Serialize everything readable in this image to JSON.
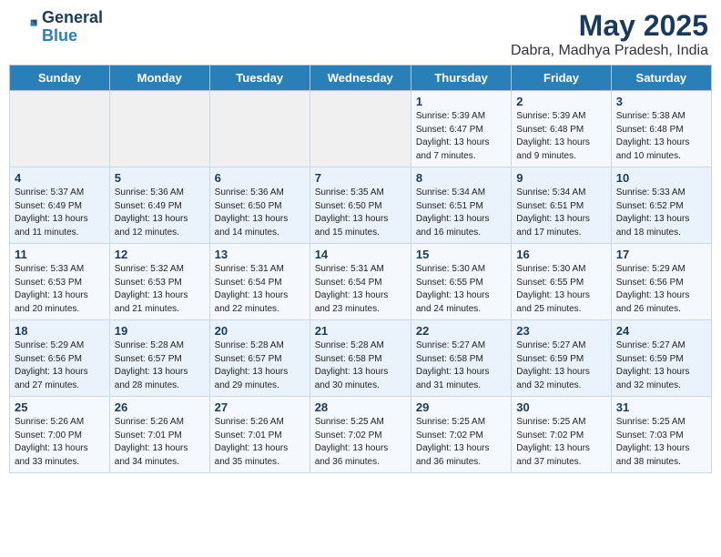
{
  "logo": {
    "line1": "General",
    "line2": "Blue"
  },
  "title": "May 2025",
  "subtitle": "Dabra, Madhya Pradesh, India",
  "days_of_week": [
    "Sunday",
    "Monday",
    "Tuesday",
    "Wednesday",
    "Thursday",
    "Friday",
    "Saturday"
  ],
  "weeks": [
    [
      {
        "day": "",
        "content": ""
      },
      {
        "day": "",
        "content": ""
      },
      {
        "day": "",
        "content": ""
      },
      {
        "day": "",
        "content": ""
      },
      {
        "day": "1",
        "content": "Sunrise: 5:39 AM\nSunset: 6:47 PM\nDaylight: 13 hours\nand 7 minutes."
      },
      {
        "day": "2",
        "content": "Sunrise: 5:39 AM\nSunset: 6:48 PM\nDaylight: 13 hours\nand 9 minutes."
      },
      {
        "day": "3",
        "content": "Sunrise: 5:38 AM\nSunset: 6:48 PM\nDaylight: 13 hours\nand 10 minutes."
      }
    ],
    [
      {
        "day": "4",
        "content": "Sunrise: 5:37 AM\nSunset: 6:49 PM\nDaylight: 13 hours\nand 11 minutes."
      },
      {
        "day": "5",
        "content": "Sunrise: 5:36 AM\nSunset: 6:49 PM\nDaylight: 13 hours\nand 12 minutes."
      },
      {
        "day": "6",
        "content": "Sunrise: 5:36 AM\nSunset: 6:50 PM\nDaylight: 13 hours\nand 14 minutes."
      },
      {
        "day": "7",
        "content": "Sunrise: 5:35 AM\nSunset: 6:50 PM\nDaylight: 13 hours\nand 15 minutes."
      },
      {
        "day": "8",
        "content": "Sunrise: 5:34 AM\nSunset: 6:51 PM\nDaylight: 13 hours\nand 16 minutes."
      },
      {
        "day": "9",
        "content": "Sunrise: 5:34 AM\nSunset: 6:51 PM\nDaylight: 13 hours\nand 17 minutes."
      },
      {
        "day": "10",
        "content": "Sunrise: 5:33 AM\nSunset: 6:52 PM\nDaylight: 13 hours\nand 18 minutes."
      }
    ],
    [
      {
        "day": "11",
        "content": "Sunrise: 5:33 AM\nSunset: 6:53 PM\nDaylight: 13 hours\nand 20 minutes."
      },
      {
        "day": "12",
        "content": "Sunrise: 5:32 AM\nSunset: 6:53 PM\nDaylight: 13 hours\nand 21 minutes."
      },
      {
        "day": "13",
        "content": "Sunrise: 5:31 AM\nSunset: 6:54 PM\nDaylight: 13 hours\nand 22 minutes."
      },
      {
        "day": "14",
        "content": "Sunrise: 5:31 AM\nSunset: 6:54 PM\nDaylight: 13 hours\nand 23 minutes."
      },
      {
        "day": "15",
        "content": "Sunrise: 5:30 AM\nSunset: 6:55 PM\nDaylight: 13 hours\nand 24 minutes."
      },
      {
        "day": "16",
        "content": "Sunrise: 5:30 AM\nSunset: 6:55 PM\nDaylight: 13 hours\nand 25 minutes."
      },
      {
        "day": "17",
        "content": "Sunrise: 5:29 AM\nSunset: 6:56 PM\nDaylight: 13 hours\nand 26 minutes."
      }
    ],
    [
      {
        "day": "18",
        "content": "Sunrise: 5:29 AM\nSunset: 6:56 PM\nDaylight: 13 hours\nand 27 minutes."
      },
      {
        "day": "19",
        "content": "Sunrise: 5:28 AM\nSunset: 6:57 PM\nDaylight: 13 hours\nand 28 minutes."
      },
      {
        "day": "20",
        "content": "Sunrise: 5:28 AM\nSunset: 6:57 PM\nDaylight: 13 hours\nand 29 minutes."
      },
      {
        "day": "21",
        "content": "Sunrise: 5:28 AM\nSunset: 6:58 PM\nDaylight: 13 hours\nand 30 minutes."
      },
      {
        "day": "22",
        "content": "Sunrise: 5:27 AM\nSunset: 6:58 PM\nDaylight: 13 hours\nand 31 minutes."
      },
      {
        "day": "23",
        "content": "Sunrise: 5:27 AM\nSunset: 6:59 PM\nDaylight: 13 hours\nand 32 minutes."
      },
      {
        "day": "24",
        "content": "Sunrise: 5:27 AM\nSunset: 6:59 PM\nDaylight: 13 hours\nand 32 minutes."
      }
    ],
    [
      {
        "day": "25",
        "content": "Sunrise: 5:26 AM\nSunset: 7:00 PM\nDaylight: 13 hours\nand 33 minutes."
      },
      {
        "day": "26",
        "content": "Sunrise: 5:26 AM\nSunset: 7:01 PM\nDaylight: 13 hours\nand 34 minutes."
      },
      {
        "day": "27",
        "content": "Sunrise: 5:26 AM\nSunset: 7:01 PM\nDaylight: 13 hours\nand 35 minutes."
      },
      {
        "day": "28",
        "content": "Sunrise: 5:25 AM\nSunset: 7:02 PM\nDaylight: 13 hours\nand 36 minutes."
      },
      {
        "day": "29",
        "content": "Sunrise: 5:25 AM\nSunset: 7:02 PM\nDaylight: 13 hours\nand 36 minutes."
      },
      {
        "day": "30",
        "content": "Sunrise: 5:25 AM\nSunset: 7:02 PM\nDaylight: 13 hours\nand 37 minutes."
      },
      {
        "day": "31",
        "content": "Sunrise: 5:25 AM\nSunset: 7:03 PM\nDaylight: 13 hours\nand 38 minutes."
      }
    ]
  ]
}
